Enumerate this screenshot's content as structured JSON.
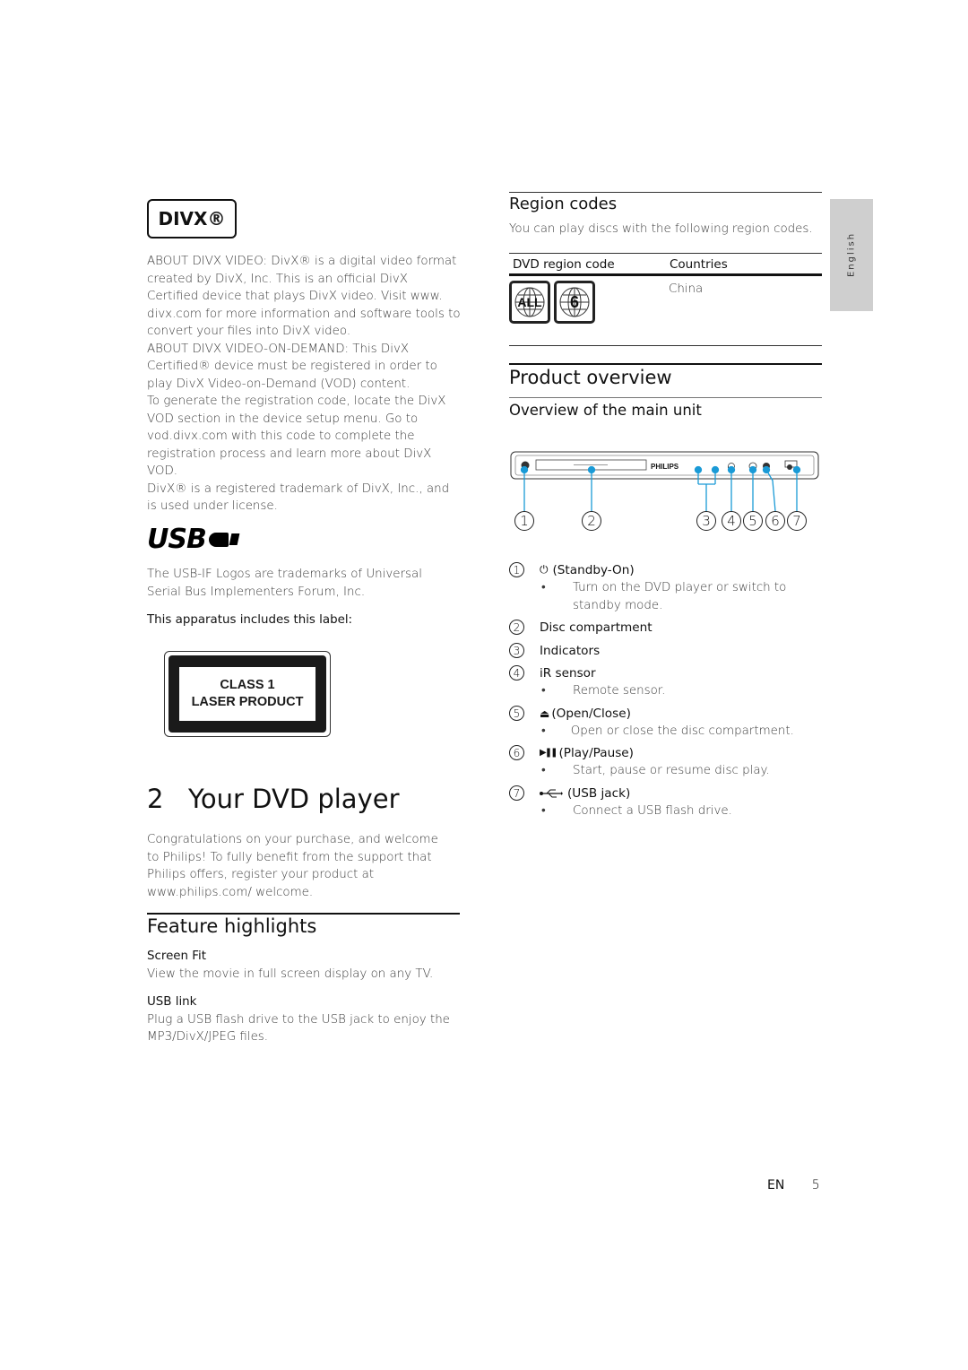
{
  "left_column": {
    "divx_logo": "DIVX®",
    "divx_paragraphs": [
      "ABOUT DIVX VIDEO: DivX® is a digital video format created by DivX, Inc. This is an official DivX Certified device that plays DivX video. Visit www. divx.com for more information and software tools to convert your files into DivX video.",
      "ABOUT DIVX VIDEO-ON-DEMAND: This DivX Certified® device must be registered in order to play DivX Video-on-Demand (VOD) content.",
      "To generate the registration code, locate the DivX VOD section in the device setup menu. Go to vod.divx.com with this code to complete the registration process and learn more about DivX VOD.",
      "DivX® is a registered trademark of DivX, Inc., and is used under license."
    ],
    "usb_logo": "USB",
    "usb_trademark": "The USB-IF Logos are trademarks of Universal Serial Bus Implementers Forum, Inc.",
    "label_intro": "This apparatus includes this label:",
    "laser_label": {
      "line1": "CLASS 1",
      "line2": "LASER PRODUCT"
    },
    "chapter": {
      "number": "2",
      "title": "Your DVD player"
    },
    "intro": "Congratulations on your purchase, and welcome to Philips! To fully benefit from the support that Philips offers, register your product at www.philips.com/ welcome.",
    "feature_highlights": {
      "title": "Feature highlights",
      "items": [
        {
          "name": "Screen Fit",
          "description": "View the movie in full screen display on any TV."
        },
        {
          "name": "USB link",
          "description": "Plug a USB flash drive to the USB jack to enjoy the MP3/DivX/JPEG files."
        }
      ]
    }
  },
  "right_column": {
    "region_codes": {
      "title": "Region codes",
      "description": "You can play discs with the following region codes.",
      "table": {
        "headers": [
          "DVD region code",
          "Countries"
        ],
        "rows": [
          {
            "codes": [
              "ALL",
              "6"
            ],
            "country": "China"
          }
        ]
      }
    },
    "product_overview": {
      "title": "Product overview",
      "subtitle": "Overview of the main unit",
      "brand": "PHILIPS",
      "callouts": [
        "1",
        "2",
        "3",
        "4",
        "5",
        "6",
        "7"
      ],
      "items": [
        {
          "number": "1",
          "icon": "power-icon",
          "icon_glyph": "⏻",
          "label": "(Standby-On)",
          "bullet": "Turn on the DVD player or switch to standby mode."
        },
        {
          "number": "2",
          "icon": "",
          "icon_glyph": "",
          "label": "Disc compartment",
          "bullet": ""
        },
        {
          "number": "3",
          "icon": "",
          "icon_glyph": "",
          "label": "Indicators",
          "bullet": ""
        },
        {
          "number": "4",
          "icon": "",
          "icon_glyph": "",
          "label": "iR sensor",
          "bullet": "Remote sensor."
        },
        {
          "number": "5",
          "icon": "eject-icon",
          "icon_glyph": "⏏",
          "label": "(Open/Close)",
          "bullet": "Open or close the disc compartment."
        },
        {
          "number": "6",
          "icon": "play-pause-icon",
          "icon_glyph": "▶❚❚",
          "label": "(Play/Pause)",
          "bullet": "Start, pause or resume disc play."
        },
        {
          "number": "7",
          "icon": "usb-icon",
          "icon_glyph": "•⇠",
          "label": "(USB jack)",
          "bullet": "Connect a USB flash drive."
        }
      ]
    }
  },
  "side_tab": {
    "language": "English"
  },
  "footer": {
    "lang": "EN",
    "page": "5"
  },
  "bullet_char": "•"
}
